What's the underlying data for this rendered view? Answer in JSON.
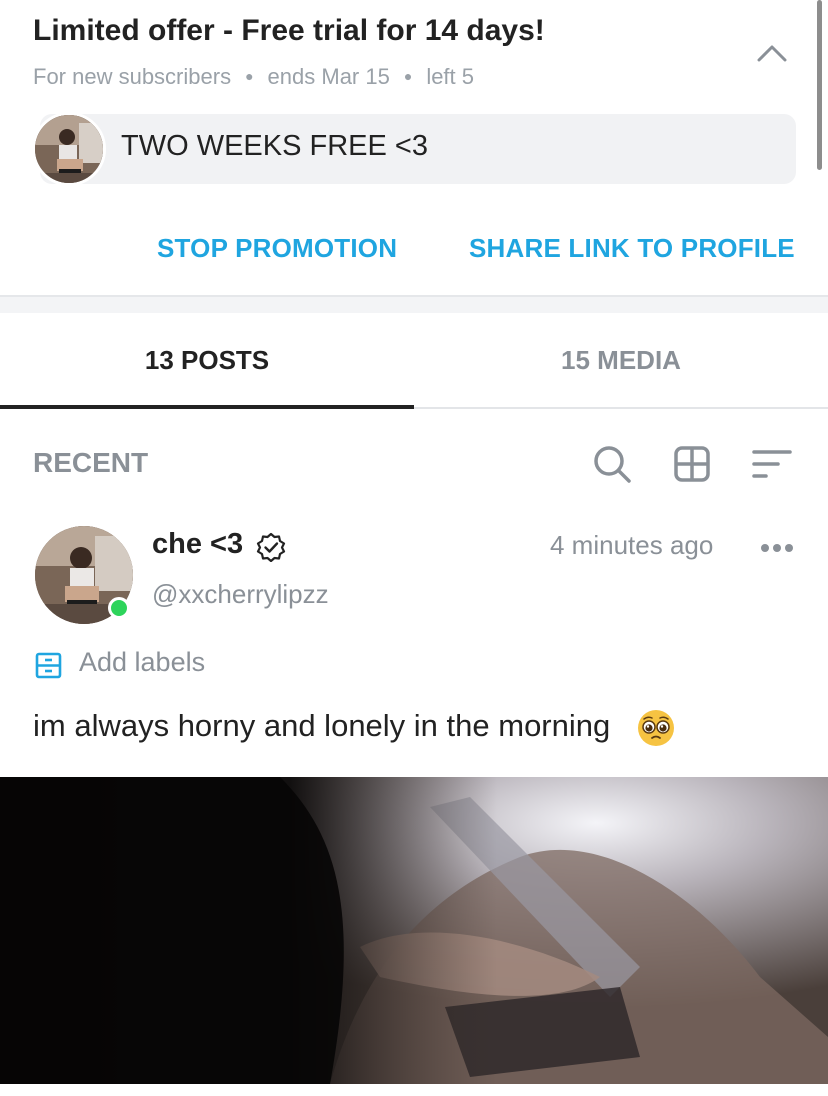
{
  "promo": {
    "title": "Limited offer - Free trial for 14 days!",
    "meta": [
      "For new subscribers",
      "ends Mar 15",
      "left 5"
    ],
    "message": "TWO WEEKS FREE <3",
    "actions": {
      "stop": "STOP PROMOTION",
      "share": "SHARE LINK TO PROFILE"
    },
    "accent_color": "#1fa5e0"
  },
  "tabs": [
    {
      "label": "13 POSTS",
      "active": true
    },
    {
      "label": "15 MEDIA",
      "active": false
    }
  ],
  "feed": {
    "section_label": "RECENT",
    "tools": [
      "search-icon",
      "grid-icon",
      "sort-icon"
    ]
  },
  "post": {
    "author_name": "che <3",
    "handle": "@xxcherrylipzz",
    "time": "4 minutes ago",
    "labels_action": "Add labels",
    "text": "im always horny and lonely in the morning",
    "emoji": "pleading-face",
    "online": true
  }
}
